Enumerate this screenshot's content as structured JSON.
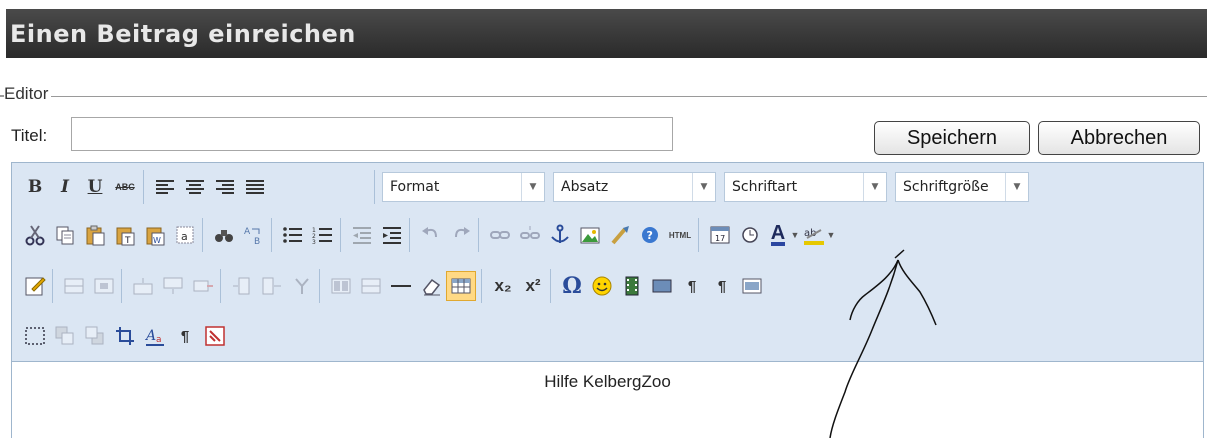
{
  "page_title": "Einen Beitrag einreichen",
  "legend": "Editor",
  "titel": {
    "label": "Titel:",
    "value": "",
    "placeholder": ""
  },
  "buttons": {
    "save": "Speichern",
    "cancel": "Abbrechen"
  },
  "toolbar": {
    "row1": {
      "bold": "B",
      "italic": "I",
      "underline": "U",
      "strike": "ABC",
      "format": "Format",
      "absatz": "Absatz",
      "schriftart": "Schriftart",
      "schriftgroesse": "Schriftgröße"
    },
    "html_label": "HTML",
    "subscript": "x₂",
    "superscript": "x²",
    "omega": "Ω",
    "pilcrow": "¶",
    "font_letter": "A"
  },
  "content": {
    "text": "Hilfe KelbergZoo"
  },
  "colors": {
    "title_bar": "#333333",
    "toolbar_bg": "#dbe6f3",
    "toolbar_border": "#9fb6cd"
  }
}
